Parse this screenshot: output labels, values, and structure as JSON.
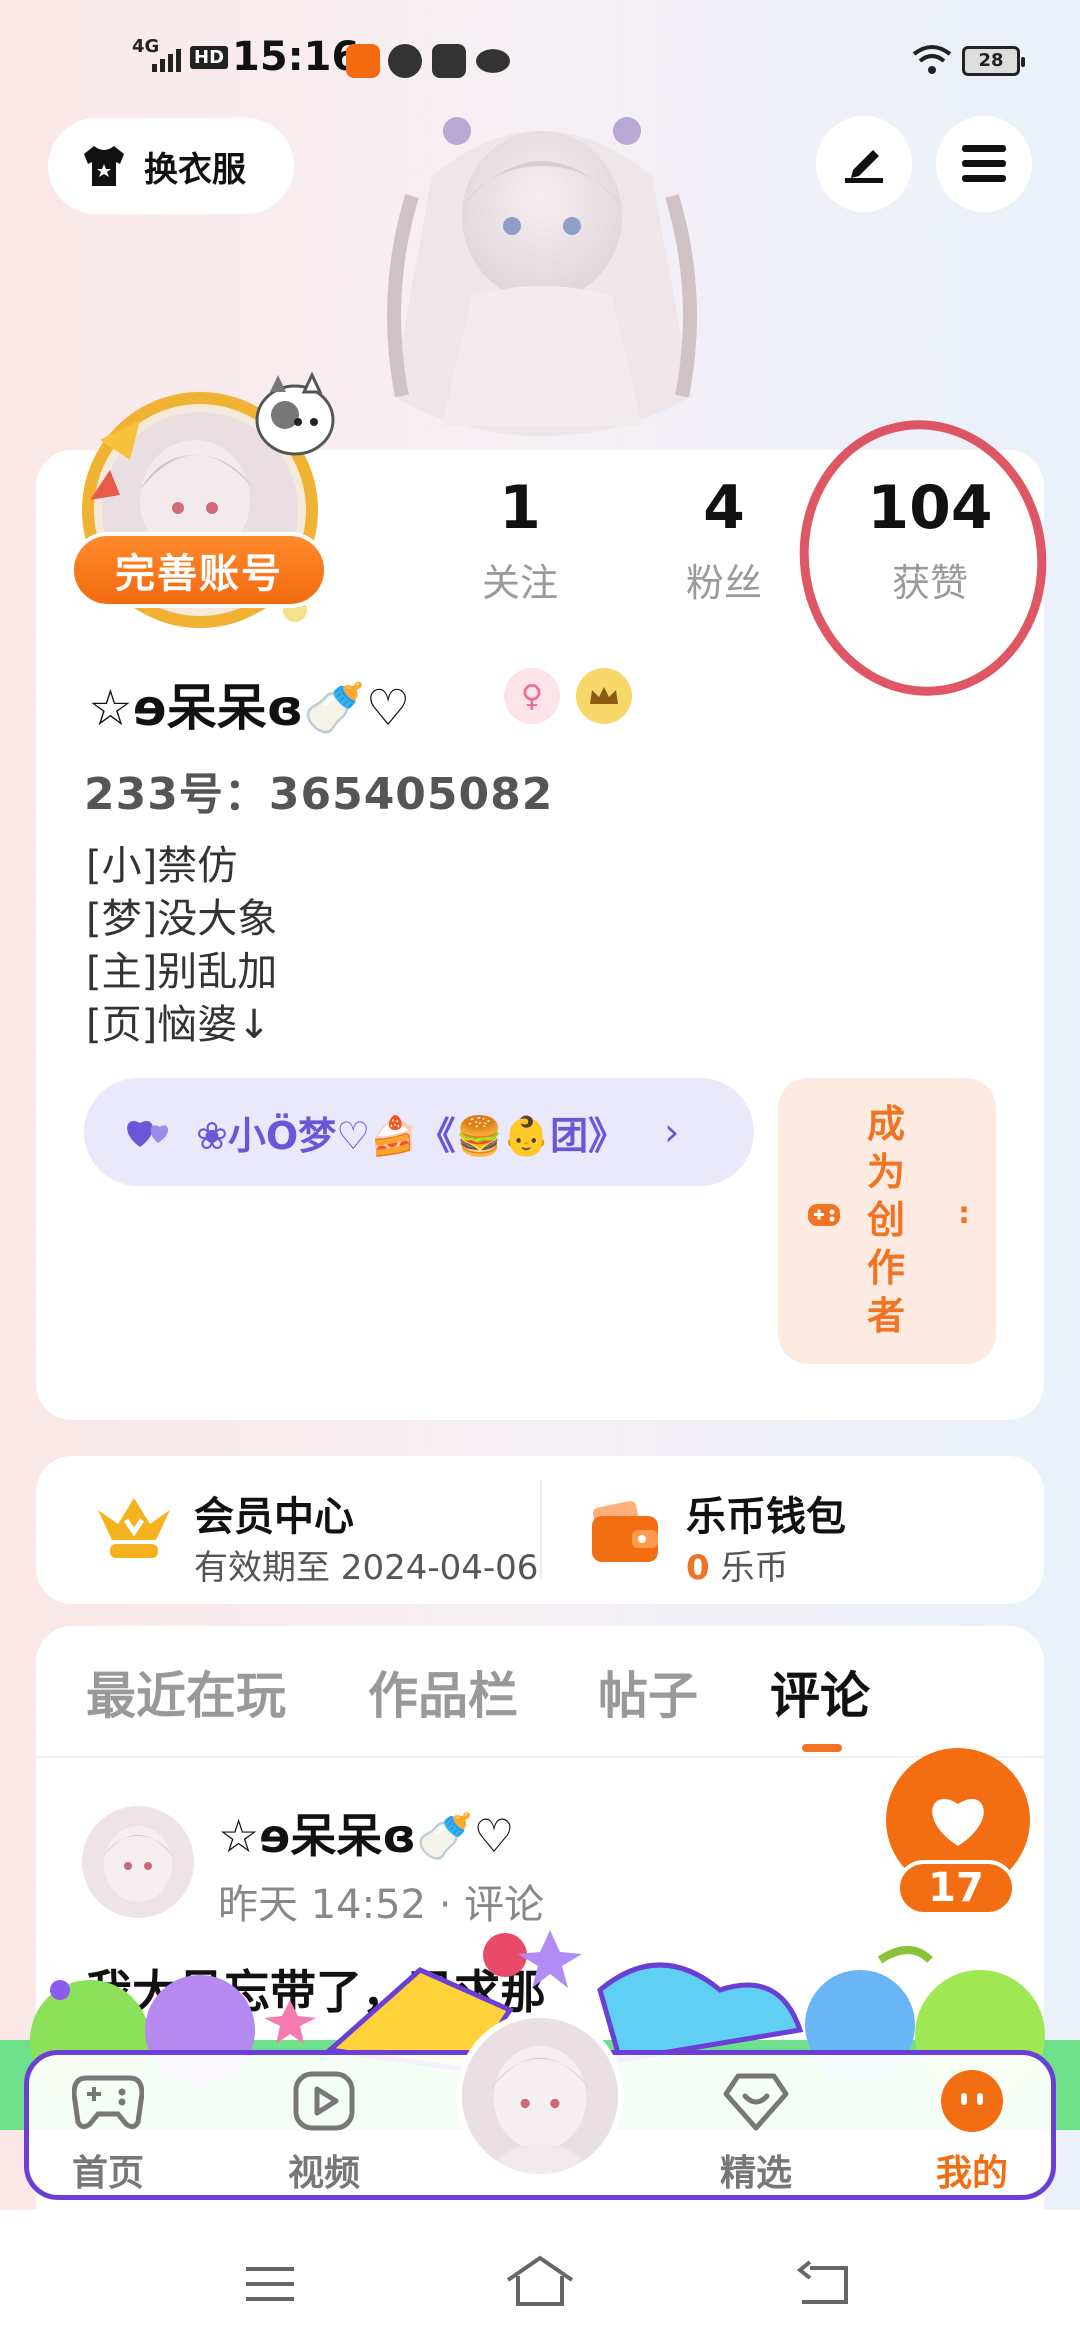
{
  "status_bar": {
    "network": "4G",
    "hd": "HD",
    "time": "15:16",
    "battery": "28"
  },
  "header": {
    "outfit_label": "换衣服"
  },
  "profile": {
    "perfect_account": "完善账号",
    "stats": [
      {
        "num": "1",
        "label": "关注"
      },
      {
        "num": "4",
        "label": "粉丝"
      },
      {
        "num": "104",
        "label": "获赞"
      }
    ],
    "username": "☆ɘ呆呆ɞ🍼♡",
    "gender_icon": "♀",
    "uid": "233号：365405082",
    "bio": [
      "[小]禁仿",
      "[梦]没大象",
      "[主]别乱加",
      "[页]恼婆↓"
    ],
    "group": "❀小Ö梦♡🍰《🍔👶团》",
    "creator_label": [
      "成",
      "为",
      "创",
      "作",
      "者"
    ]
  },
  "member": {
    "vip_title": "会员中心",
    "vip_sub": "有效期至 2024-04-06",
    "wallet_title": "乐币钱包",
    "wallet_amount": "0",
    "wallet_unit": "乐币"
  },
  "tabs": [
    "最近在玩",
    "作品栏",
    "帖子",
    "评论"
  ],
  "active_tab": "评论",
  "comment": {
    "author": "☆ɘ呆呆ɞ🍼♡",
    "time": "昨天 14:52 · 评论",
    "body": "我大号忘带了，已求那"
  },
  "like_count": "17",
  "nav": [
    "首页",
    "视频",
    "精选",
    "我的"
  ],
  "colors": {
    "accent": "#f36d12",
    "purple": "#6c55d9",
    "red_mark": "#d93a4a"
  }
}
